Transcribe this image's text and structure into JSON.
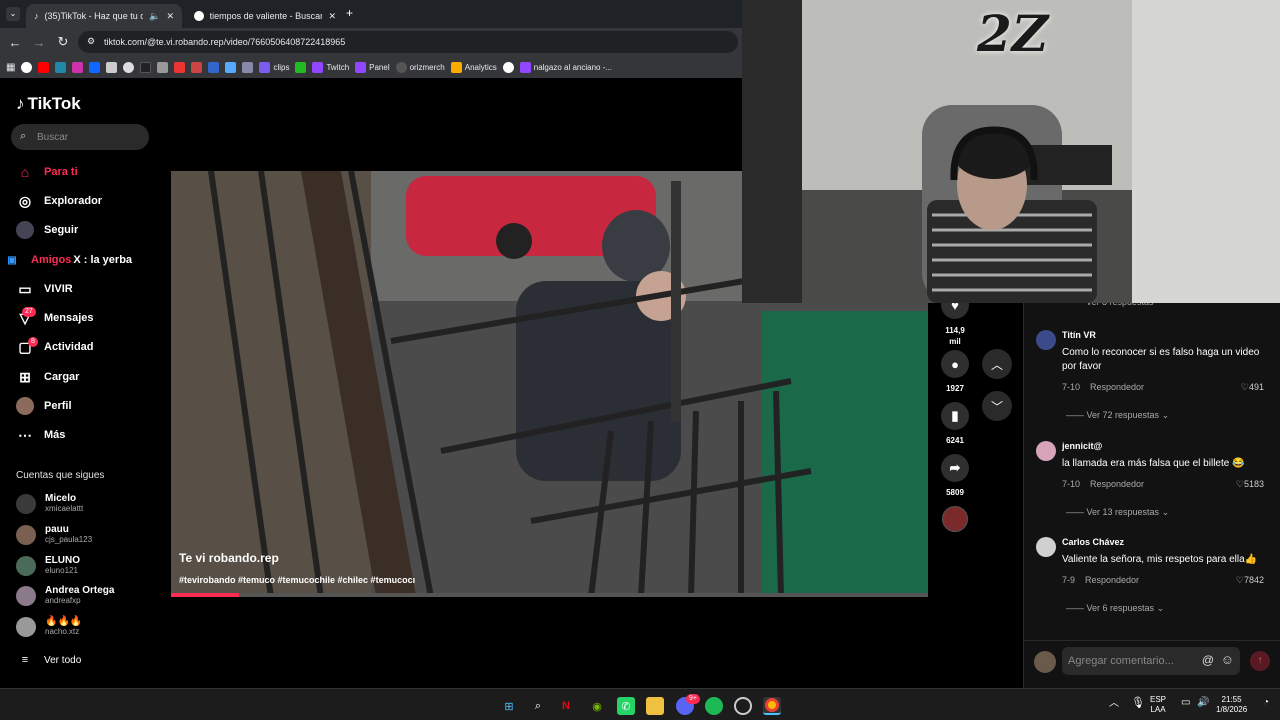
{
  "browser": {
    "tabs": [
      {
        "label": "(35)TikTok - Haz que tu día",
        "active": true
      },
      {
        "label": "tiempos de valiente - Buscar co",
        "active": false
      }
    ],
    "new_tab": "+",
    "url": "tiktok.com/@te.vi.robando.rep/video/7660506408722418965",
    "bookmarks": [
      "clips",
      "Twitch",
      "Panel",
      "orizmerch",
      "Analytics",
      "nalgazo al anciano -..."
    ]
  },
  "sidebar": {
    "logo": "TikTok",
    "search_placeholder": "Buscar",
    "nav": [
      {
        "label": "Para ti",
        "icon": "home-icon"
      },
      {
        "label": "Explorador",
        "icon": "compass-icon"
      },
      {
        "label": "Seguir",
        "icon": "following-icon"
      },
      {
        "label": "Amigos",
        "icon": "friends-icon"
      },
      {
        "label": "VIVIR",
        "icon": "live-icon"
      },
      {
        "label": "Mensajes",
        "icon": "messages-icon",
        "badge": "27"
      },
      {
        "label": "Actividad",
        "icon": "activity-icon",
        "badge": "8"
      },
      {
        "label": "Cargar",
        "icon": "upload-icon"
      },
      {
        "label": "Perfil",
        "icon": "profile-icon"
      },
      {
        "label": "Más",
        "icon": "more-icon"
      }
    ],
    "friends_overlay": "X : la yerba",
    "following_title": "Cuentas que sigues",
    "accounts": [
      {
        "name": "Micelo",
        "handle": "xmicaelattt"
      },
      {
        "name": "pauu",
        "handle": "cjs_paula123"
      },
      {
        "name": "ELUNO",
        "handle": "eluno121"
      },
      {
        "name": "Andrea Ortega",
        "handle": "andreafxp"
      },
      {
        "name": "🔥🔥🔥",
        "handle": "nacho.xtz"
      }
    ],
    "see_all": "Ver todo"
  },
  "video": {
    "caption": "Te vi robando.rep",
    "tags": "#tevirobando #temuco #temucochile #chilec #temucocı",
    "progress": 0.09
  },
  "actions": {
    "likes": "114,9 mil",
    "comments": "1927",
    "saves": "6241",
    "shares": "5809"
  },
  "comments": {
    "top_more": "Ver 8 respuestas",
    "items": [
      {
        "user": "Titín VR",
        "text": "Como lo reconocer si es falso haga un video por favor",
        "date": "7-10",
        "reply": "Respondedor",
        "likes": "491",
        "more": "Ver 72 respuestas",
        "avatar": "#3b4a8a"
      },
      {
        "user": "jennicit@",
        "text": "la llamada era más falsa que el billete 😂",
        "date": "7-10",
        "reply": "Respondedor",
        "likes": "5183",
        "more": "Ver 13 respuestas",
        "avatar": "#d7a3b8"
      },
      {
        "user": "Carlos Chávez",
        "text": "Valiente la señora, mis respetos para ella👍",
        "date": "7-9",
        "reply": "Respondedor",
        "likes": "7842",
        "more": "Ver 6 respuestas",
        "avatar": "#d0d0d0"
      }
    ],
    "input_placeholder": "Agregar comentario..."
  },
  "webcam": {
    "logo": "2Z"
  },
  "taskbar": {
    "lang": "ESP",
    "lang2": "LAA",
    "time": "21:55",
    "date": "1/8/2026",
    "discord_badge": "9+"
  }
}
